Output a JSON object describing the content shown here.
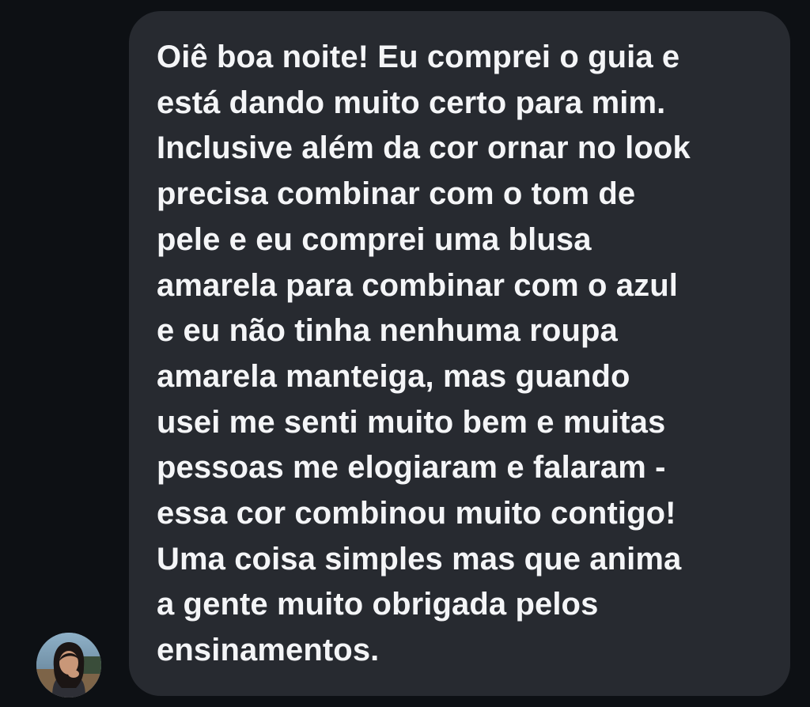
{
  "conversation": {
    "message": {
      "lines": [
        "Oiê boa noite! Eu comprei o guia e",
        "está dando muito certo para mim.",
        "Inclusive além da cor ornar no look",
        "precisa combinar com o tom de",
        "pele e eu comprei uma blusa",
        "amarela para combinar com o azul",
        "e eu não tinha nenhuma roupa",
        "amarela manteiga, mas guando",
        "usei me senti muito bem e muitas",
        "pessoas me elogiaram e falaram -",
        "essa cor combinou muito contigo!",
        "Uma coisa simples mas que anima",
        "a gente muito obrigada pelos",
        "ensinamentos."
      ]
    },
    "sender": {
      "avatar": "user-avatar"
    }
  },
  "theme": {
    "background": "#0d1014",
    "bubble": "#272a30",
    "text": "#f4f5f7"
  }
}
